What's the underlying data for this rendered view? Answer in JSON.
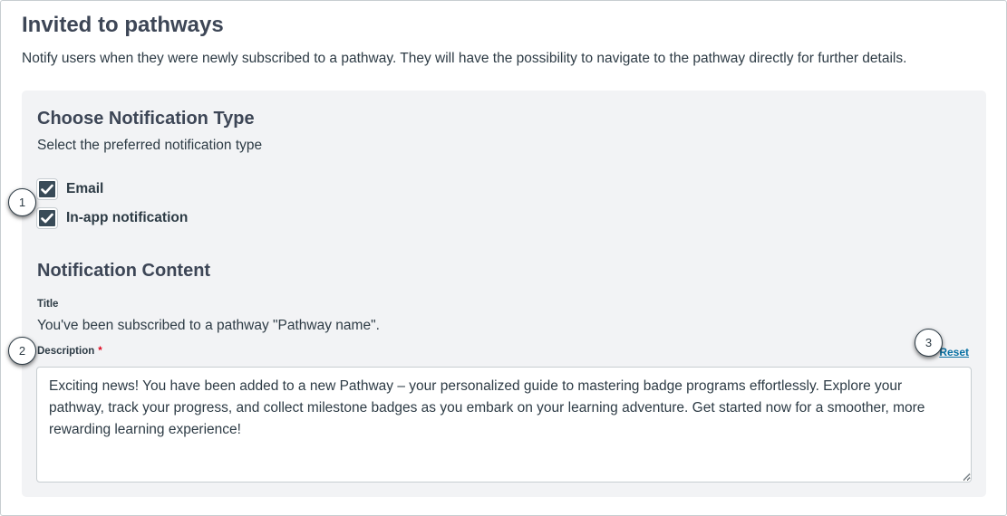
{
  "header": {
    "title": "Invited to pathways",
    "description": "Notify users when they were newly subscribed to a pathway. They will have the possibility to navigate to the pathway directly for further details."
  },
  "notification_type": {
    "title": "Choose Notification Type",
    "subtitle": "Select the preferred notification type",
    "options": [
      {
        "label": "Email",
        "checked": true,
        "icon": "check-icon"
      },
      {
        "label": "In-app notification",
        "checked": true,
        "icon": "check-icon"
      }
    ]
  },
  "notification_content": {
    "title": "Notification Content",
    "title_label": "Title",
    "title_value": "You've been subscribed to a pathway \"Pathway name\".",
    "description_label": "Description",
    "required_marker": "*",
    "reset_label": "Reset",
    "description_value": "Exciting news! You have been added to a new Pathway – your personalized guide to mastering badge programs effortlessly. Explore your pathway, track your progress, and collect milestone badges as you embark on your learning adventure. Get started now for a smoother, more rewarding learning experience!"
  },
  "callouts": [
    "1",
    "2",
    "3"
  ],
  "colors": {
    "panel": "#f2f3f5",
    "checkbox": "#394b58",
    "link": "#0770a3",
    "required": "#e0061f"
  }
}
